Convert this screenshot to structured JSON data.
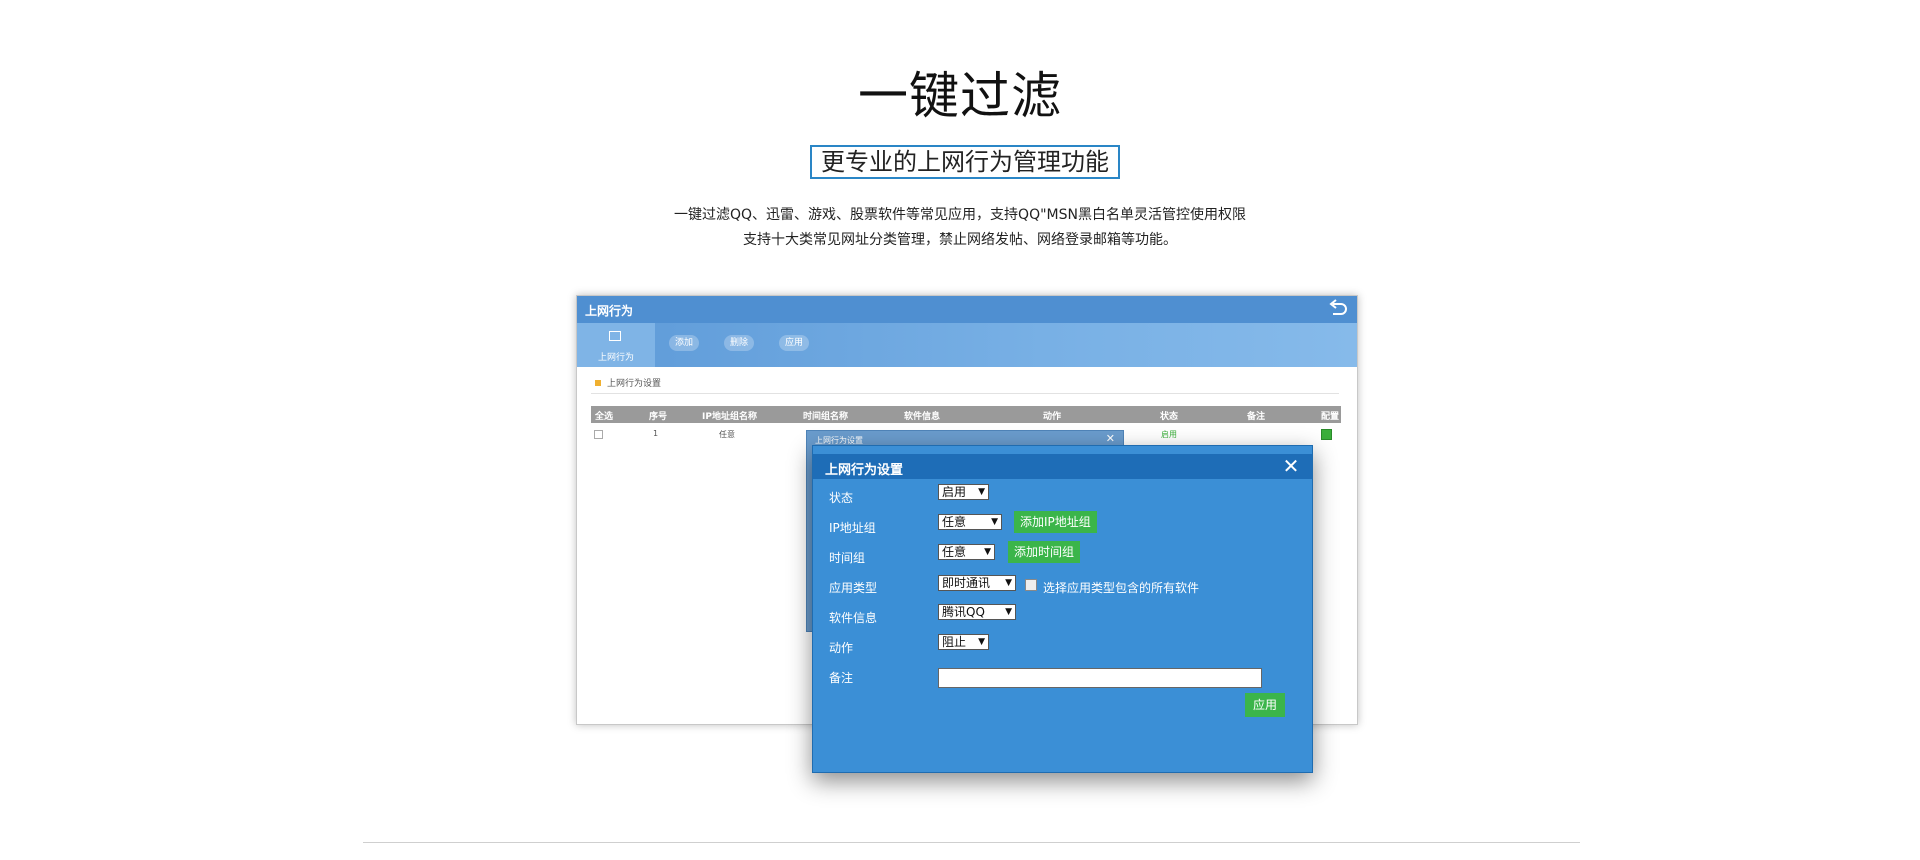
{
  "hero": {
    "title": "一键过滤",
    "subtitle": "更专业的上网行为管理功能",
    "desc_line1": "一键过滤QQ、迅雷、游戏、股票软件等常见应用，支持QQ\"MSN黑白名单灵活管控使用权限",
    "desc_line2": "支持十大类常见网址分类管理，禁止网络发帖、网络登录邮箱等功能。"
  },
  "app": {
    "title": "上网行为",
    "toolbar": {
      "active_label": "上网行为",
      "add": "添加",
      "delete": "删除",
      "apply": "应用"
    },
    "section": "上网行为设置",
    "table": {
      "headers": [
        "全选",
        "序号",
        "IP地址组名称",
        "时间组名称",
        "软件信息",
        "动作",
        "状态",
        "备注",
        "配置"
      ],
      "row": {
        "index": "1",
        "ip_group": "任意",
        "status": "启用"
      }
    },
    "ghost_dialog_title": "上网行为设置"
  },
  "dialog": {
    "title": "上网行为设置",
    "fields": {
      "status_label": "状态",
      "status_value": "启用",
      "ip_label": "IP地址组",
      "ip_value": "任意",
      "add_ip_button": "添加IP地址组",
      "time_label": "时间组",
      "time_value": "任意",
      "add_time_button": "添加时间组",
      "app_type_label": "应用类型",
      "app_type_value": "即时通讯",
      "all_apps_checkbox": "选择应用类型包含的所有软件",
      "software_label": "软件信息",
      "software_value": "腾讯QQ",
      "action_label": "动作",
      "action_value": "阻止",
      "remark_label": "备注",
      "remark_value": ""
    },
    "apply_button": "应用"
  },
  "colors": {
    "dialog_bg": "#3b8fd6",
    "dialog_title_bg": "#1e6db7",
    "button_green": "#3bb54a",
    "accent_border": "#2a86c6"
  }
}
